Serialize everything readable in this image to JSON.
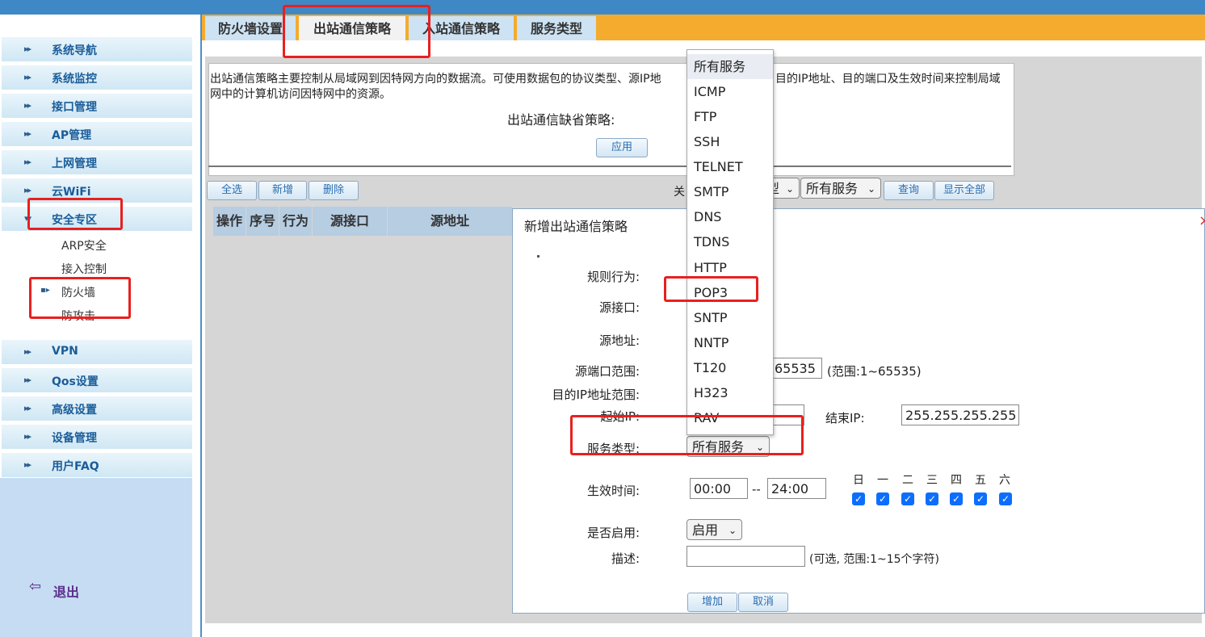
{
  "sidebar": {
    "items": [
      {
        "label": "系统导航"
      },
      {
        "label": "系统监控"
      },
      {
        "label": "接口管理"
      },
      {
        "label": "AP管理"
      },
      {
        "label": "上网管理"
      },
      {
        "label": "云WiFi"
      },
      {
        "label": "安全专区"
      },
      {
        "label": "VPN"
      },
      {
        "label": "Qos设置"
      },
      {
        "label": "高级设置"
      },
      {
        "label": "设备管理"
      },
      {
        "label": "用户FAQ"
      }
    ],
    "sub_items": [
      {
        "label": "ARP安全"
      },
      {
        "label": "接入控制"
      },
      {
        "label": "防火墙"
      },
      {
        "label": "防攻击"
      }
    ],
    "logout_label": "退出"
  },
  "tabs": [
    {
      "label": "防火墙设置"
    },
    {
      "label": "出站通信策略"
    },
    {
      "label": "入站通信策略"
    },
    {
      "label": "服务类型"
    }
  ],
  "info": {
    "line1": "出站通信策略主要控制从局域网到因特网方向的数据流。可使用数据包的协议类型、源IP地",
    "line1_tail": "目的IP地址、目的端口及生效时间来控制局域",
    "line2": "网中的计算机访问因特网中的资源。",
    "default_policy_label": "出站通信缺省策略:",
    "apply_label": "应用"
  },
  "toolbar": {
    "select_all": "全选",
    "add": "新增",
    "delete": "删除",
    "filter_label_partial": "关",
    "filter_select_partial": "型",
    "service_select": "所有服务",
    "query": "查询",
    "show_all": "显示全部"
  },
  "table": {
    "headers": [
      "操作",
      "序号",
      "行为",
      "源接口",
      "源地址"
    ]
  },
  "dialog": {
    "title": "新增出站通信策略",
    "rule_action_label": "规则行为:",
    "src_iface_label": "源接口:",
    "src_addr_label": "源地址:",
    "src_port_label": "源端口范围:",
    "src_port_end_partial": "65535",
    "src_port_range_hint": "(范围:1~65535)",
    "dst_ip_range_label": "目的IP地址范围:",
    "start_ip_label": "起始IP:",
    "end_ip_label": "结束IP:",
    "end_ip_value": "255.255.255.255",
    "service_type_label": "服务类型:",
    "service_type_value": "所有服务",
    "effective_time_label": "生效时间:",
    "time_start": "00:00",
    "time_sep": "--",
    "time_end": "24:00",
    "days": [
      "日",
      "一",
      "二",
      "三",
      "四",
      "五",
      "六"
    ],
    "days_checked": [
      true,
      true,
      true,
      true,
      true,
      true,
      true
    ],
    "enable_label": "是否启用:",
    "enable_value": "启用",
    "desc_label": "描述:",
    "desc_value": "",
    "desc_hint": "(可选, 范围:1~15个字符)",
    "add_button": "增加",
    "cancel_button": "取消"
  },
  "dropdown": {
    "options": [
      "所有服务",
      "ICMP",
      "FTP",
      "SSH",
      "TELNET",
      "SMTP",
      "DNS",
      "TDNS",
      "HTTP",
      "POP3",
      "SNTP",
      "NNTP",
      "T120",
      "H323",
      "RAV"
    ],
    "selected": "所有服务"
  },
  "colors": {
    "topbar": "#3f88c6",
    "tabbar": "#f5ab2e",
    "nav_text": "#1a5d9a",
    "annotation_red": "#e8201f",
    "checkbox_blue": "#0d6efd"
  }
}
